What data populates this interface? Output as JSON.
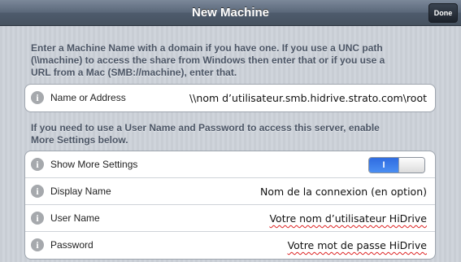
{
  "navbar": {
    "title": "New Machine",
    "done_label": "Done"
  },
  "section1": {
    "header_lines": [
      "Enter a Machine Name with a domain if you have one.  If you use a UNC path",
      "(\\\\machine) to access the share from Windows then enter that or if you use a",
      "URL from a Mac (SMB://machine), enter that."
    ],
    "rows": [
      {
        "label": "Name or Address",
        "value": "\\\\nom d’utilisateur.smb.hidrive.strato.com\\root"
      }
    ]
  },
  "section2": {
    "header_lines": [
      "If you need to use a User Name and Password to access this server, enable",
      "More Settings below."
    ],
    "rows": [
      {
        "label": "Show More Settings",
        "toggle_label": "I",
        "toggle_on": true
      },
      {
        "label": "Display Name",
        "value": "Nom de la connexion (en option)"
      },
      {
        "label": "User Name",
        "value": "Votre nom d’utilisateur HiDrive"
      },
      {
        "label": "Password",
        "value": "Votre mot de passe HiDrive"
      }
    ]
  },
  "icons": {
    "info": "info-icon",
    "info_glyph": "i"
  },
  "colors": {
    "toggle_on": "#2f6ce0",
    "header_text": "#4b5565"
  }
}
